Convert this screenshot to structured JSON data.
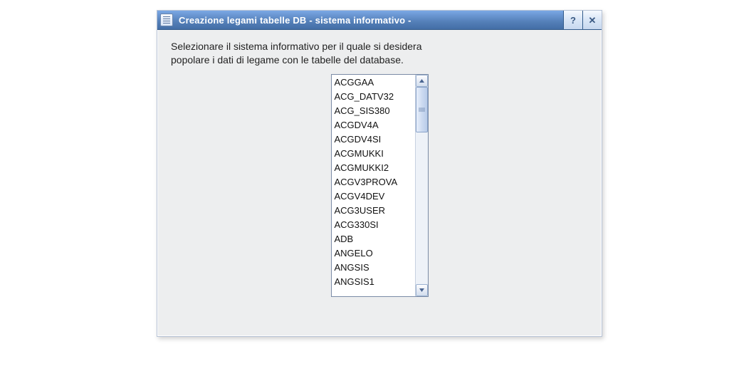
{
  "window": {
    "title": "Creazione legami tabelle DB - sistema informativo -",
    "help_label": "?",
    "close_label": "✕"
  },
  "instruction": {
    "line1": "Selezionare il sistema informativo per il quale si desidera",
    "line2": "popolare i dati di legame con le tabelle del database."
  },
  "listbox": {
    "items": [
      "ACGGAA",
      "ACG_DATV32",
      "ACG_SIS380",
      "ACGDV4A",
      "ACGDV4SI",
      "ACGMUKKI",
      "ACGMUKKI2",
      "ACGV3PROVA",
      "ACGV4DEV",
      "ACG3USER",
      "ACG330SI",
      "ADB",
      "ANGELO",
      "ANGSIS",
      "ANGSIS1"
    ]
  }
}
